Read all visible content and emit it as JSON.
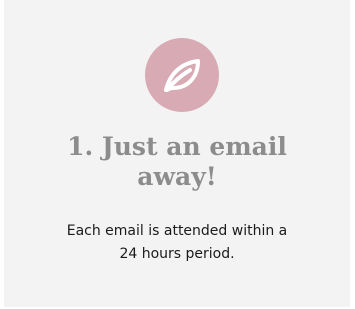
{
  "card": {
    "icon": "leaf-icon",
    "icon_bg_color": "#d8aab4",
    "title_line1": "1. Just an email",
    "title_line2": "away!",
    "description_line1": "Each email is attended within a",
    "description_line2": "24 hours period."
  }
}
